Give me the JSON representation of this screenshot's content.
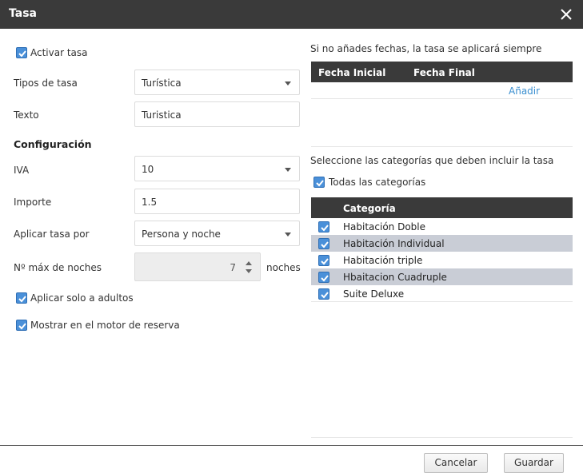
{
  "dialog": {
    "title": "Tasa"
  },
  "form": {
    "activate_label": "Activar tasa",
    "type_label": "Tipos de tasa",
    "type_value": "Turística",
    "text_label": "Texto",
    "text_value": "Turistica",
    "config_heading": "Configuración",
    "vat_label": "IVA",
    "vat_value": "10",
    "amount_label": "Importe",
    "amount_value": "1.5",
    "apply_by_label": "Aplicar tasa por",
    "apply_by_value": "Persona y noche",
    "max_nights_label": "Nº máx de noches",
    "max_nights_value": "7",
    "nights_unit": "noches",
    "adults_only_label": "Aplicar solo a adultos",
    "show_engine_label": "Mostrar en el motor de reserva"
  },
  "dates": {
    "hint": "Si no añades fechas, la tasa se aplicará siempre",
    "col_start": "Fecha Inicial",
    "col_end": "Fecha Final",
    "add_link": "Añadir"
  },
  "categories": {
    "hint": "Seleccione las categorías que deben incluir la tasa",
    "all_label": "Todas las categorías",
    "header": "Categoría",
    "items": [
      {
        "label": "Habitación Doble",
        "checked": true
      },
      {
        "label": "Habitación Individual",
        "checked": true
      },
      {
        "label": "Habitación triple",
        "checked": true
      },
      {
        "label": "Hbaitacion Cuadruple",
        "checked": true
      },
      {
        "label": "Suite Deluxe",
        "checked": true
      }
    ]
  },
  "footer": {
    "cancel": "Cancelar",
    "save": "Guardar"
  },
  "colors": {
    "titlebar": "#3a3a3a",
    "checkbox": "#4a90d9",
    "link": "#3a8fd0",
    "row_alt": "#c9cdd6"
  }
}
